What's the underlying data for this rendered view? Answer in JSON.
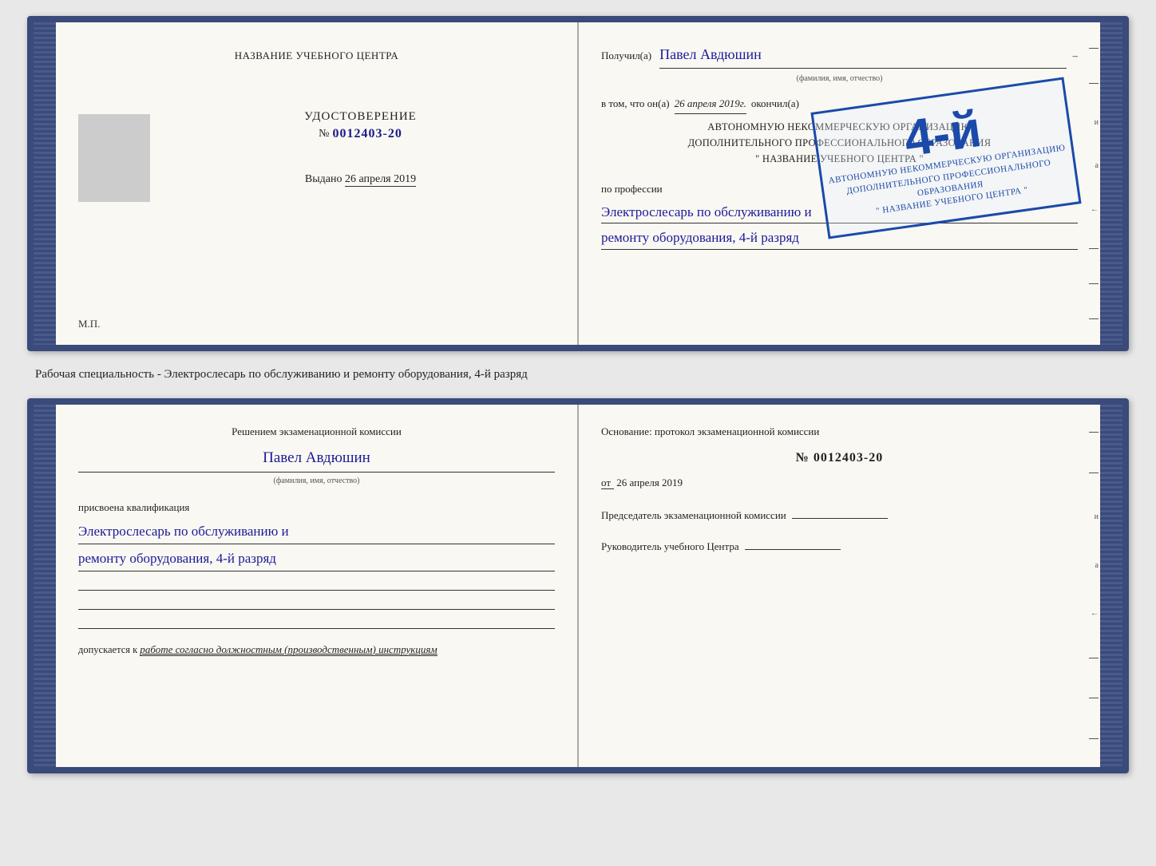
{
  "page": {
    "background": "#e8e8e8"
  },
  "specialty_label": {
    "text": "Рабочая специальность - Электрослесарь по обслуживанию и ремонту оборудования, 4-й разряд"
  },
  "top_spread": {
    "left_page": {
      "header": "НАЗВАНИЕ УЧЕБНОГО ЦЕНТРА",
      "cert_word": "УДОСТОВЕРЕНИЕ",
      "cert_number_prefix": "№",
      "cert_number": "0012403-20",
      "issued_label": "Выдано",
      "issued_date": "26 апреля 2019",
      "mp_label": "М.П."
    },
    "right_page": {
      "received_label": "Получил(а)",
      "name": "Павел Авдюшин",
      "fio_label": "(фамилия, имя, отчество)",
      "date_prefix": "в том, что он(а)",
      "date_value": "26 апреля 2019г.",
      "finished_label": "окончил(а)",
      "org_line1": "АВТОНОМНУЮ НЕКОММЕРЧЕСКУЮ ОРГАНИЗАЦИЮ",
      "org_line2": "ДОПОЛНИТЕЛЬНОГО ПРОФЕССИОНАЛЬНОГО ОБРАЗОВАНИЯ",
      "org_line3": "\" НАЗВАНИЕ УЧЕБНОГО ЦЕНТРА \"",
      "profession_label": "по профессии",
      "profession_line1": "Электрослесарь по обслуживанию и",
      "profession_line2": "ремонту оборудования, 4-й разряд",
      "stamp": {
        "grade": "4-й",
        "line1": "АВТОНОМНУЮ НЕКОММЕРЧЕСКУЮ ОРГАНИЗАЦИЮ",
        "line2": "ДОПОЛНИТЕЛЬНОГО ПРОФЕССИОНАЛЬНОГО ОБРАЗОВАНИЯ",
        "line3": "\" НАЗВАНИЕ УЧЕБНОГО ЦЕНТРА \""
      }
    }
  },
  "bottom_spread": {
    "left_page": {
      "commission_text": "Решением экзаменационной комиссии",
      "person_name": "Павел Авдюшин",
      "fio_label": "(фамилия, имя, отчество)",
      "qualification_label": "присвоена квалификация",
      "qualification_line1": "Электрослесарь по обслуживанию и",
      "qualification_line2": "ремонту оборудования, 4-й разряд",
      "allowed_prefix": "допускается к",
      "allowed_text": "работе согласно должностным (производственным) инструкциям"
    },
    "right_page": {
      "basis_label": "Основание: протокол экзаменационной комиссии",
      "protocol_number_prefix": "№",
      "protocol_number": "0012403-20",
      "date_prefix": "от",
      "date_value": "26 апреля 2019",
      "chairman_label": "Председатель экзаменационной комиссии",
      "director_label": "Руководитель учебного Центра"
    }
  },
  "right_edge_marks": [
    "–",
    "–",
    "и",
    "а",
    "←",
    "–",
    "–",
    "–"
  ]
}
